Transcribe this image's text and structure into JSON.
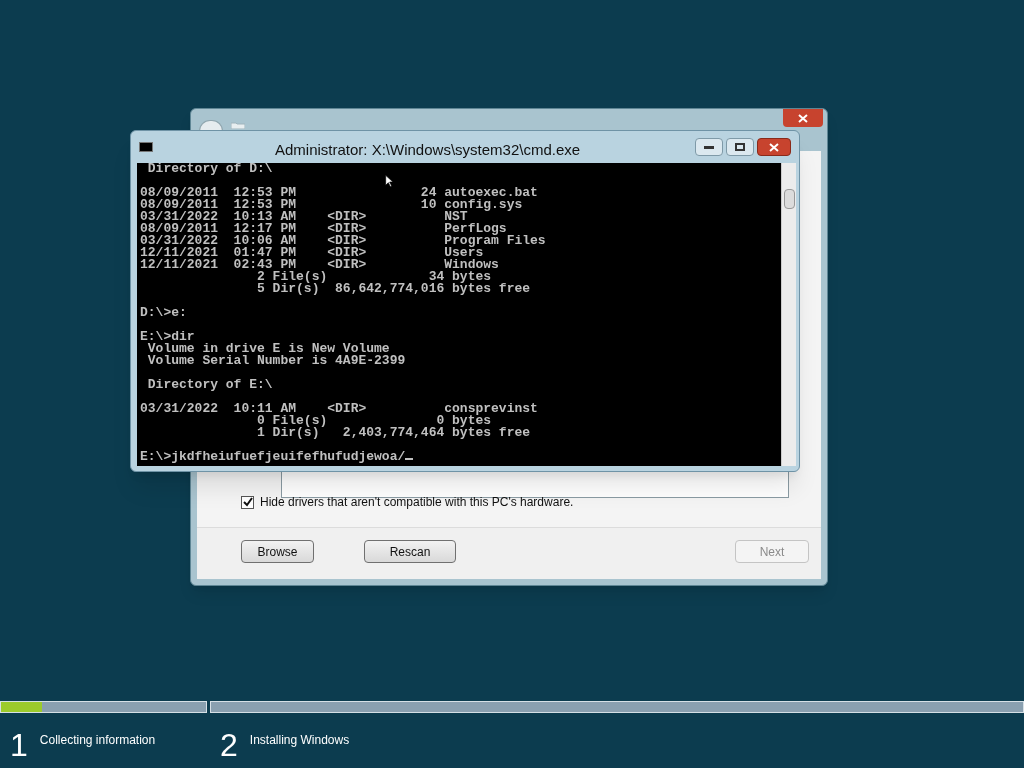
{
  "setup_window": {
    "hide_incompatible": {
      "label": "Hide drivers that aren't compatible with this PC's hardware.",
      "checked": true
    },
    "buttons": [
      {
        "label": "Browse",
        "disabled": false
      },
      {
        "label": "Rescan",
        "disabled": false
      },
      {
        "label": "Next",
        "disabled": true
      }
    ]
  },
  "console_window": {
    "title": "Administrator: X:\\Windows\\system32\\cmd.exe",
    "blocks": [
      [
        " Directory of D:\\"
      ],
      [
        "08/09/2011  12:53 PM                24 autoexec.bat",
        "08/09/2011  12:53 PM                10 config.sys",
        "03/31/2022  10:13 AM    <DIR>          NST",
        "08/09/2011  12:17 PM    <DIR>          PerfLogs",
        "03/31/2022  10:06 AM    <DIR>          Program Files",
        "12/11/2021  01:47 PM    <DIR>          Users",
        "12/11/2021  02:43 PM    <DIR>          Windows",
        "               2 File(s)             34 bytes",
        "               5 Dir(s)  86,642,774,016 bytes free"
      ],
      [
        "D:\\>e:"
      ],
      [
        "E:\\>dir",
        " Volume in drive E is New Volume",
        " Volume Serial Number is 4A9E-2399"
      ],
      [
        " Directory of E:\\"
      ],
      [
        "03/31/2022  10:11 AM    <DIR>          consprevinst",
        "               0 File(s)              0 bytes",
        "               1 Dir(s)   2,403,774,464 bytes free"
      ],
      [
        "E:\\>jkdfheiufuefjeuifefhufudjewoa/"
      ]
    ]
  },
  "progress_steps": [
    {
      "number": "1",
      "label": "Collecting information",
      "level": 0.2
    },
    {
      "number": "2",
      "label": "Installing Windows",
      "level": 0
    }
  ]
}
